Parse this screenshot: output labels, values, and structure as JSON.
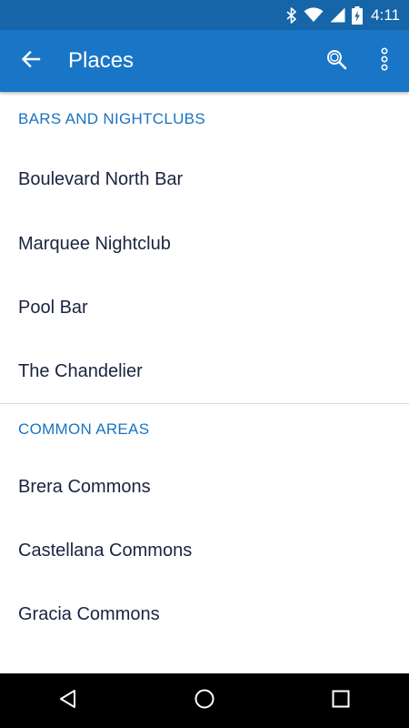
{
  "status_bar": {
    "time": "4:11",
    "icons": [
      "bluetooth-icon",
      "wifi-icon",
      "cell-signal-icon",
      "battery-charging-icon"
    ]
  },
  "app_bar": {
    "title": "Places",
    "back_icon": "arrow-left-icon",
    "search_icon": "search-icon",
    "more_icon": "more-vert-icon"
  },
  "sections": [
    {
      "header": "BARS AND NIGHTCLUBS",
      "items": [
        "Boulevard North Bar",
        "Marquee Nightclub",
        "Pool Bar",
        "The Chandelier"
      ]
    },
    {
      "header": "COMMON AREAS",
      "items": [
        "Brera Commons",
        "Castellana Commons",
        "Gracia Commons"
      ]
    }
  ],
  "nav_bar": {
    "icons": [
      "back-triangle-icon",
      "home-circle-icon",
      "recents-square-icon"
    ]
  },
  "colors": {
    "status_bar": "#1565a8",
    "app_bar": "#1976c6",
    "section_header": "#1a73c0",
    "item_text": "#1b2340",
    "nav_bar": "#000000"
  }
}
